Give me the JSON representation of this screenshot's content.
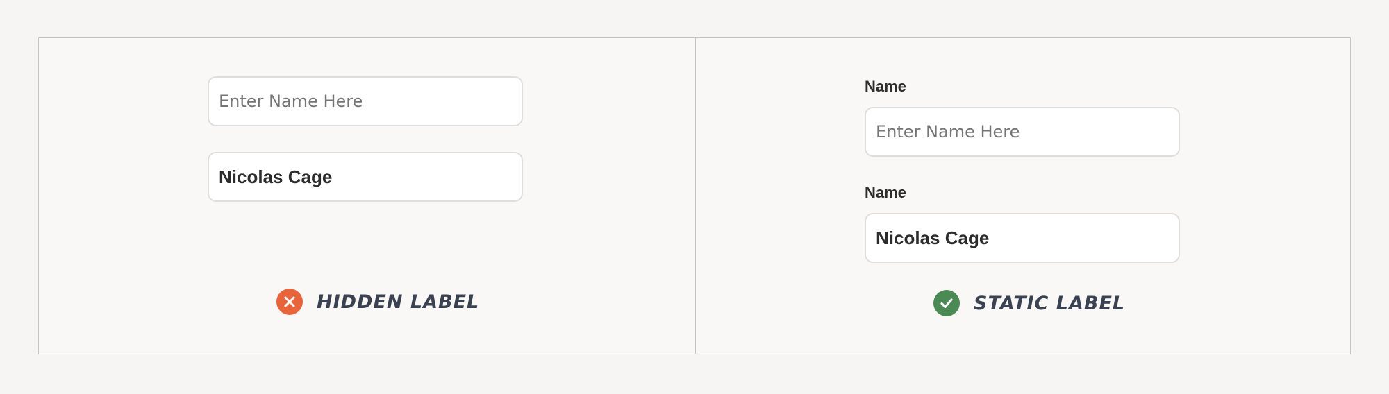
{
  "left_panel": {
    "empty_input": {
      "placeholder": "Enter Name Here"
    },
    "filled_input": {
      "value": "Nicolas Cage"
    },
    "verdict": {
      "text": "HIDDEN LABEL",
      "status": "bad",
      "color": "#e8643a",
      "icon": "close-icon"
    }
  },
  "right_panel": {
    "empty_field": {
      "label": "Name",
      "placeholder": "Enter Name Here"
    },
    "filled_field": {
      "label": "Name",
      "value": "Nicolas Cage"
    },
    "verdict": {
      "text": "STATIC LABEL",
      "status": "good",
      "color": "#4b8a55",
      "icon": "check-icon"
    }
  }
}
